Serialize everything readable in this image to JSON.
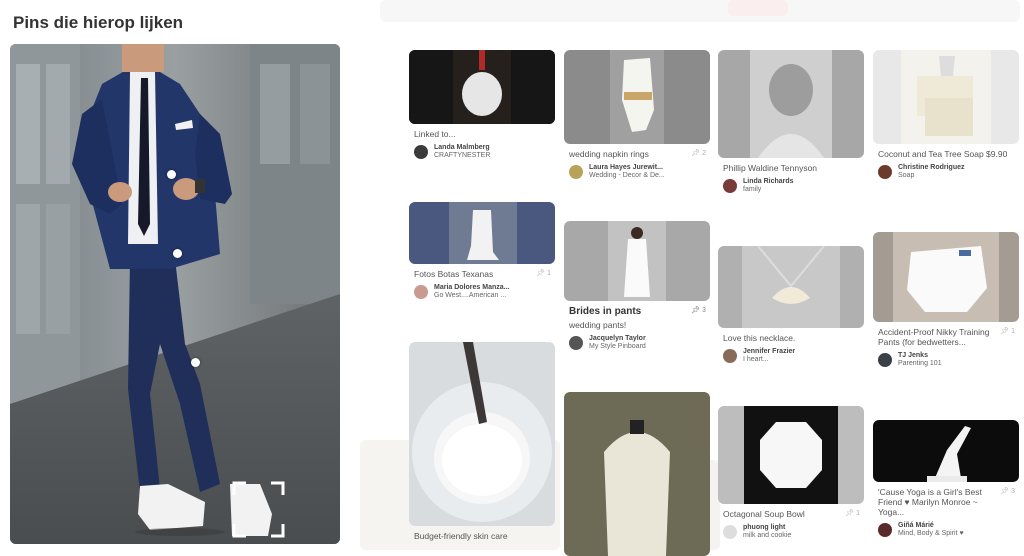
{
  "panel": {
    "title": "Pins die hierop lijken"
  },
  "hero": {
    "hotspots": [
      "hotspot-jacket",
      "hotspot-trousers-upper",
      "hotspot-trousers-knee"
    ],
    "crop_selector": "crop-selector-shoes"
  },
  "columns": [
    [
      {
        "caption": "Linked to...",
        "repins": "",
        "user": "Landa Malmberg",
        "board": "CRAFTYNESTER",
        "avatar": "#3b3b3b"
      },
      {
        "caption": "Fotos Botas Texanas",
        "repins": "1",
        "user": "Maria Dolores Manza...",
        "board": "Go West....American ...",
        "avatar": "#c99a8f"
      },
      {
        "caption": "Budget-friendly skin care",
        "repins": "",
        "user": "",
        "board": "",
        "avatar": ""
      }
    ],
    [
      {
        "caption": "wedding napkin rings",
        "repins": "2",
        "user": "Laura Hayes Jurewit...",
        "board": "Wedding - Decor & De...",
        "avatar": "#b9a35a"
      },
      {
        "title": "Brides in pants",
        "caption": "wedding pants!",
        "repins": "3",
        "user": "Jacquelyn Taylor",
        "board": "My Style Pinboard",
        "avatar": "#555"
      },
      {
        "caption": "",
        "repins": "",
        "user": "",
        "board": "",
        "avatar": ""
      }
    ],
    [
      {
        "caption": "Phillip Waldine Tennyson",
        "repins": "",
        "user": "Linda Richards",
        "board": "family",
        "avatar": "#7a3a3a"
      },
      {
        "caption": "Love this necklace.",
        "repins": "",
        "user": "Jennifer Frazier",
        "board": "I heart...",
        "avatar": "#8a6b5a"
      },
      {
        "caption": "Octagonal Soup Bowl",
        "repins": "1",
        "user": "phuong light",
        "board": "milk and cookie",
        "avatar": "#ddd"
      }
    ],
    [
      {
        "caption": "Coconut and Tea Tree Soap $9.90",
        "repins": "",
        "user": "Christine Rodriguez",
        "board": "Soap",
        "avatar": "#6b3a2a"
      },
      {
        "caption": "Accident-Proof Nikky Training Pants (for bedwetters...",
        "repins": "1",
        "user": "TJ Jenks",
        "board": "Parenting 101",
        "avatar": "#3a3f48"
      },
      {
        "caption": "'Cause Yoga is a Girl's Best Friend ♥ Marilyn Monroe ~ Yoga...",
        "repins": "3",
        "user": "Giñá Márié",
        "board": "Mind, Body & Spirit ♥",
        "avatar": "#5a2a2a"
      }
    ]
  ],
  "colors": {
    "title": "#333333",
    "caption": "#555555",
    "repin": "#aaaaaa",
    "hotspot": "#ffffff"
  },
  "icons": [
    "pin-icon",
    "hotspot-dot-icon",
    "crop-corner-icon",
    "avatar"
  ]
}
